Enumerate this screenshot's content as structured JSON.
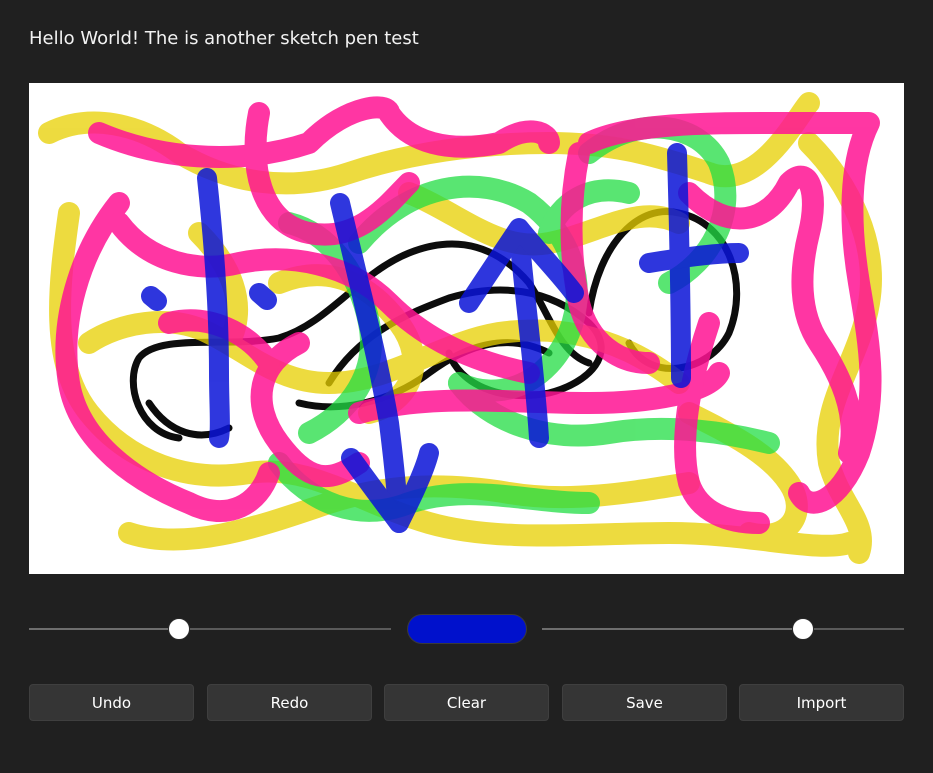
{
  "title": "Hello World! The is another sketch pen test",
  "sliders": {
    "left": {
      "value_fraction": 0.415
    },
    "right": {
      "value_fraction": 0.72
    }
  },
  "color_swatch": {
    "color": "#0011cc"
  },
  "buttons": {
    "undo": "Undo",
    "redo": "Redo",
    "clear": "Clear",
    "save": "Save",
    "import": "Import"
  },
  "pen_colors": {
    "yellow": "#e8d000",
    "pink": "#ff1493",
    "green": "#22dd44",
    "blue": "#0a14d8",
    "black": "#000000"
  }
}
